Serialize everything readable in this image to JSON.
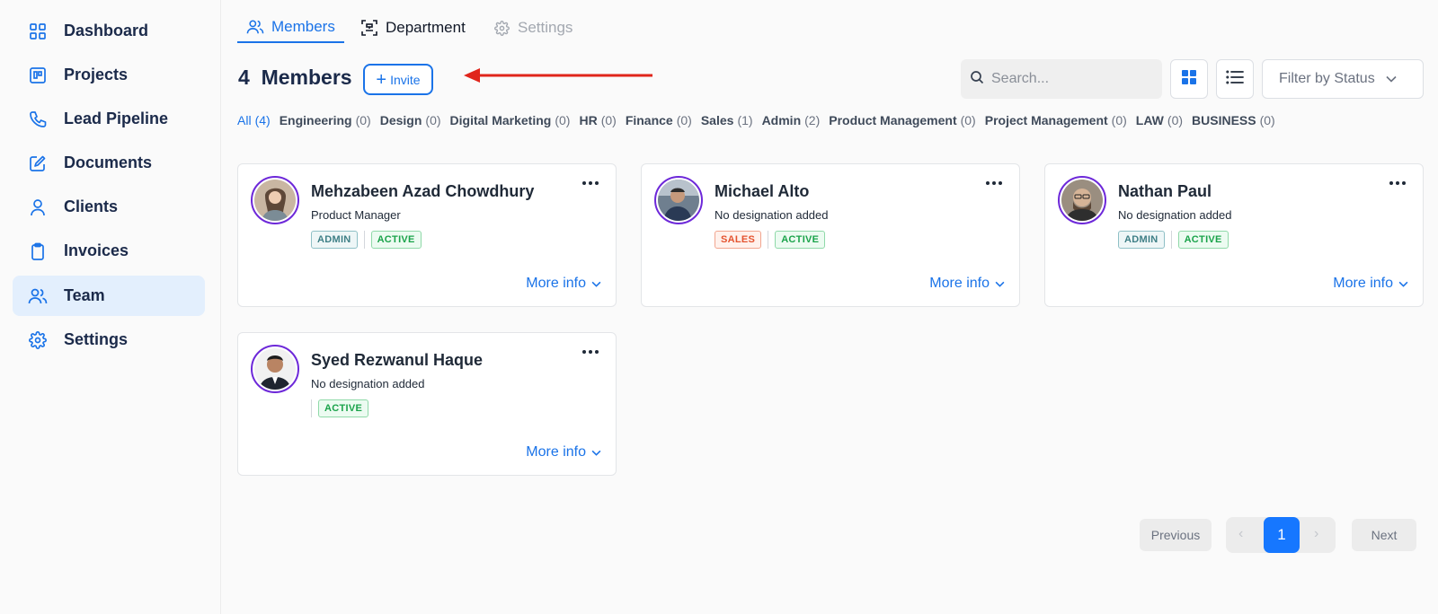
{
  "sidebar": {
    "items": [
      {
        "label": "Dashboard",
        "icon": "dashboard-icon"
      },
      {
        "label": "Projects",
        "icon": "projects-icon"
      },
      {
        "label": "Lead Pipeline",
        "icon": "phone-icon"
      },
      {
        "label": "Documents",
        "icon": "edit-icon"
      },
      {
        "label": "Clients",
        "icon": "user-icon"
      },
      {
        "label": "Invoices",
        "icon": "clipboard-icon"
      },
      {
        "label": "Team",
        "icon": "users-icon",
        "active": true
      },
      {
        "label": "Settings",
        "icon": "gear-icon"
      }
    ]
  },
  "tabs": [
    {
      "label": "Members",
      "state": "active"
    },
    {
      "label": "Department",
      "state": "normal"
    },
    {
      "label": "Settings",
      "state": "disabled"
    }
  ],
  "header": {
    "count": "4",
    "title": "Members",
    "invite_label": "Invite",
    "search_placeholder": "Search...",
    "filter_label": "Filter by Status"
  },
  "categories": [
    {
      "name": "All",
      "count": "(4)",
      "active": true
    },
    {
      "name": "Engineering",
      "count": "(0)"
    },
    {
      "name": "Design",
      "count": "(0)"
    },
    {
      "name": "Digital Marketing",
      "count": "(0)"
    },
    {
      "name": "HR",
      "count": "(0)"
    },
    {
      "name": "Finance",
      "count": "(0)"
    },
    {
      "name": "Sales",
      "count": "(1)"
    },
    {
      "name": "Admin",
      "count": "(2)"
    },
    {
      "name": "Product Management",
      "count": "(0)"
    },
    {
      "name": "Project Management",
      "count": "(0)"
    },
    {
      "name": "LAW",
      "count": "(0)"
    },
    {
      "name": "BUSINESS",
      "count": "(0)"
    }
  ],
  "members": [
    {
      "name": "Mehzabeen Azad Chowdhury",
      "designation": "Product Manager",
      "department": "ADMIN",
      "status": "ACTIVE",
      "more_label": "More info"
    },
    {
      "name": "Michael Alto",
      "designation": "No designation added",
      "department": "SALES",
      "status": "ACTIVE",
      "more_label": "More info"
    },
    {
      "name": "Nathan Paul",
      "designation": "No designation added",
      "department": "ADMIN",
      "status": "ACTIVE",
      "more_label": "More info"
    },
    {
      "name": "Syed Rezwanul Haque",
      "designation": "No designation added",
      "department": "",
      "status": "ACTIVE",
      "more_label": "More info"
    }
  ],
  "pagination": {
    "previous_label": "Previous",
    "next_label": "Next",
    "current_page": "1"
  },
  "colors": {
    "accent": "#1a73e8",
    "active_bg": "#e3effd",
    "annotation_arrow": "#e0251b"
  }
}
